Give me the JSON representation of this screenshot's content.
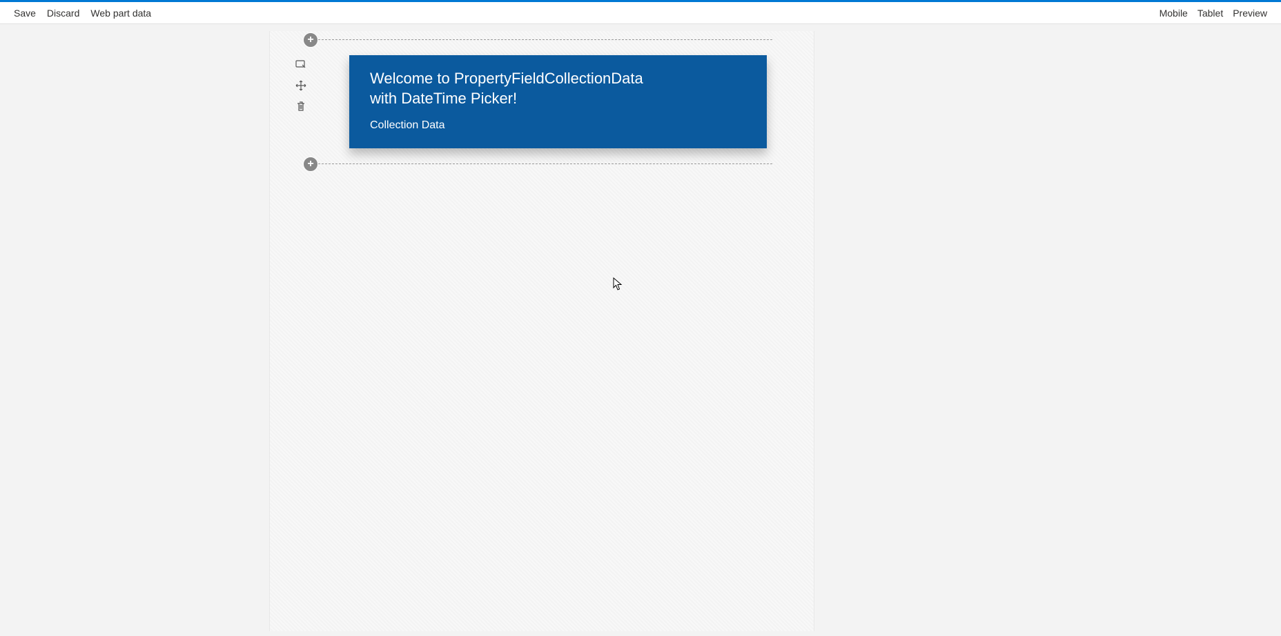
{
  "toolbar": {
    "left": {
      "save": "Save",
      "discard": "Discard",
      "webpartdata": "Web part data"
    },
    "right": {
      "mobile": "Mobile",
      "tablet": "Tablet",
      "preview": "Preview"
    }
  },
  "webpart": {
    "title": "Welcome to PropertyFieldCollectionData with DateTime Picker!",
    "subtitle": "Collection Data"
  }
}
